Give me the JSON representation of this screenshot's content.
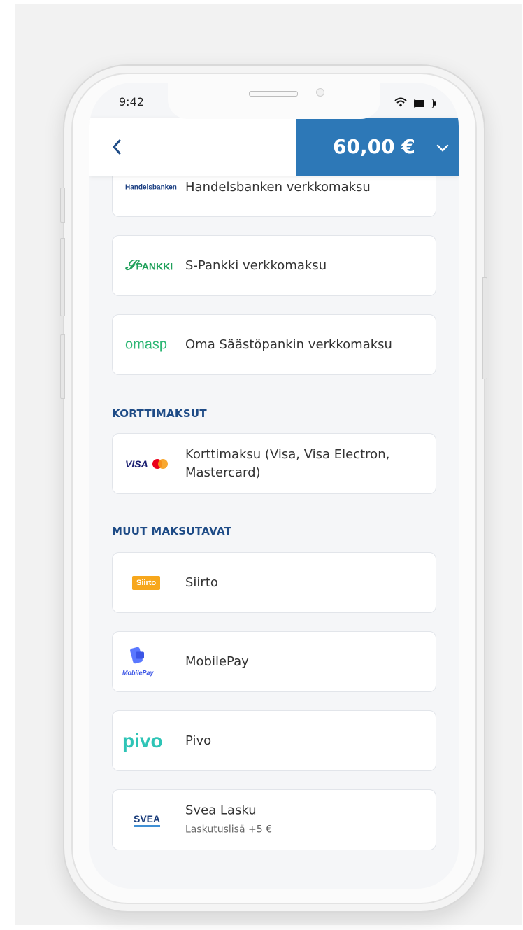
{
  "status": {
    "time": "9:42"
  },
  "header": {
    "amount": "60,00 €"
  },
  "colors": {
    "accent": "#2d78b7",
    "section": "#1e4b86",
    "siirto": "#f7a71c",
    "omasp": "#2bb673",
    "pivo": "#2ec4b6"
  },
  "banks": [
    {
      "logo_text": "Handelsbanken",
      "label": "Handelsbanken verkkomaksu"
    },
    {
      "logo_text": "PANKKI",
      "label": "S-Pankki verkkomaksu"
    },
    {
      "logo_text": "omasp",
      "label": "Oma Säästöpankin verkkomaksu"
    }
  ],
  "sections": {
    "cards_title": "KORTTIMAKSUT",
    "other_title": "MUUT MAKSUTAVAT"
  },
  "card_payment": {
    "logo_text": "VISA",
    "label_line1": "Korttimaksu (Visa, Visa Electron,",
    "label_line2": "Mastercard)"
  },
  "other_methods": [
    {
      "logo_text": "Siirto",
      "label": "Siirto"
    },
    {
      "logo_text": "MobilePay",
      "label": "MobilePay"
    },
    {
      "logo_text": "pivo",
      "label": "Pivo"
    },
    {
      "logo_text": "SVEA",
      "label": "Svea Lasku",
      "sublabel": "Laskutuslisä +5 €"
    }
  ],
  "icons": [
    "back-chevron-icon",
    "chevron-down-icon",
    "wifi-icon",
    "battery-icon"
  ]
}
